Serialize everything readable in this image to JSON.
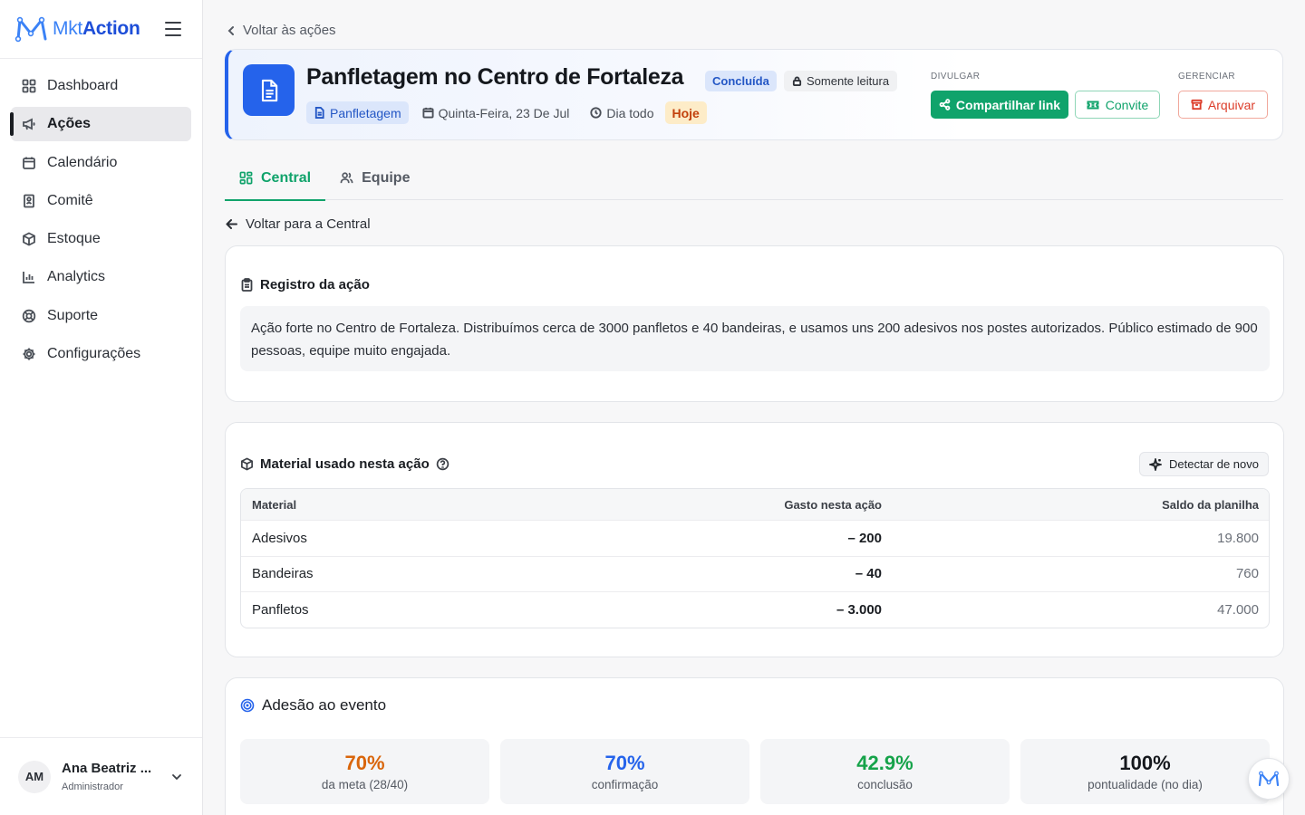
{
  "brand": {
    "prefix": "Mkt",
    "suffix": "Action"
  },
  "sidebar": {
    "items": [
      {
        "label": "Dashboard",
        "icon": "grid-icon"
      },
      {
        "label": "Ações",
        "icon": "megaphone-icon",
        "active": true
      },
      {
        "label": "Calendário",
        "icon": "calendar-icon"
      },
      {
        "label": "Comitê",
        "icon": "building-icon"
      },
      {
        "label": "Estoque",
        "icon": "box-icon"
      },
      {
        "label": "Analytics",
        "icon": "bar-chart-icon"
      },
      {
        "label": "Suporte",
        "icon": "lifebuoy-icon"
      },
      {
        "label": "Configurações",
        "icon": "gear-icon"
      }
    ],
    "user": {
      "initials": "AM",
      "name": "Ana Beatriz ...",
      "role": "Administrador"
    }
  },
  "header": {
    "back_label": "Voltar às ações",
    "title": "Panfletagem no Centro de Fortaleza",
    "status": "Concluída",
    "readonly": "Somente leitura",
    "type": "Panfletagem",
    "date": "Quinta-Feira, 23 De Jul",
    "time": "Dia todo",
    "today": "Hoje",
    "divulgar_label": "DIVULGAR",
    "gerenciar_label": "GERENCIAR",
    "share_label": "Compartilhar link",
    "invite_label": "Convite",
    "archive_label": "Arquivar"
  },
  "tabs": [
    {
      "label": "Central",
      "active": true
    },
    {
      "label": "Equipe"
    }
  ],
  "back_central": "Voltar para a Central",
  "registro": {
    "title": "Registro da ação",
    "text": "Ação forte no Centro de Fortaleza. Distribuímos cerca de 3000 panfletos e 40 bandeiras, e usamos uns 200 adesivos nos postes autorizados. Público estimado de 900 pessoas, equipe muito engajada."
  },
  "material": {
    "title": "Material usado nesta ação",
    "detect_label": "Detectar de novo",
    "columns": [
      "Material",
      "Gasto nesta ação",
      "Saldo da planilha"
    ],
    "rows": [
      {
        "name": "Adesivos",
        "spent": "– 200",
        "balance": "19.800"
      },
      {
        "name": "Bandeiras",
        "spent": "– 40",
        "balance": "760"
      },
      {
        "name": "Panfletos",
        "spent": "– 3.000",
        "balance": "47.000"
      }
    ]
  },
  "adesao": {
    "title": "Adesão ao evento",
    "stats": [
      {
        "value": "70%",
        "label": "da meta (28/40)",
        "color": "#d9650b"
      },
      {
        "value": "70%",
        "label": "confirmação",
        "color": "#2563eb"
      },
      {
        "value": "42.9%",
        "label": "conclusão",
        "color": "#16a34a"
      },
      {
        "value": "100%",
        "label": "pontualidade (no dia)",
        "color": "#15181d"
      }
    ]
  },
  "colors": {
    "accent_green": "#10a36b",
    "brand_blue": "#2563eb",
    "danger": "#dc3d2a"
  }
}
